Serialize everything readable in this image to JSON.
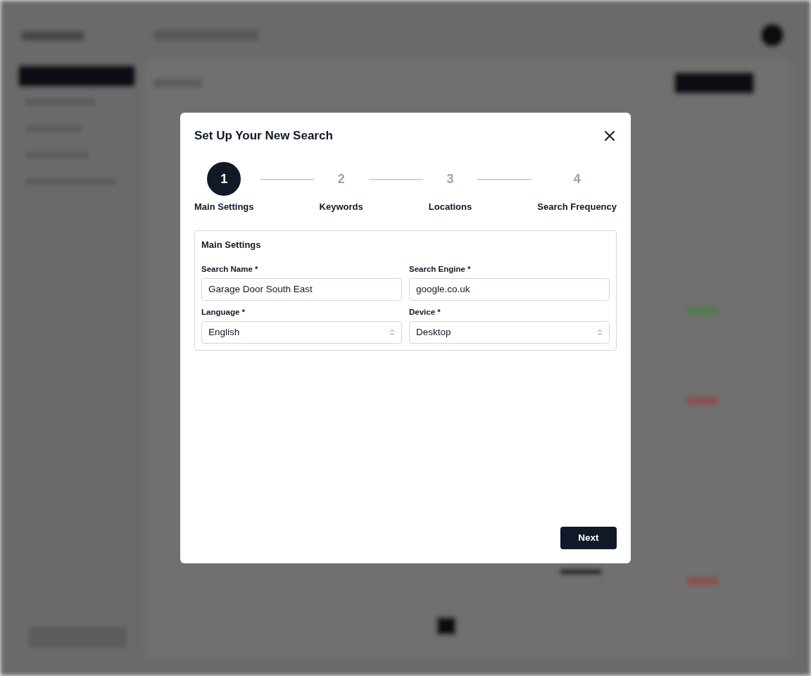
{
  "dialog": {
    "title": "Set Up Your New Search",
    "steps": [
      {
        "number": "1",
        "label": "Main Settings",
        "selected": true
      },
      {
        "number": "2",
        "label": "Keywords",
        "selected": false
      },
      {
        "number": "3",
        "label": "Locations",
        "selected": false
      },
      {
        "number": "4",
        "label": "Search Frequency",
        "selected": false
      }
    ],
    "section": {
      "title": "Main Settings",
      "fields": [
        {
          "kind": "text",
          "label": "Search Name *",
          "value": "Garage Door South East"
        },
        {
          "kind": "text",
          "label": "Search Engine *",
          "value": "google.co.uk"
        },
        {
          "kind": "select",
          "label": "Language *",
          "value": "English"
        },
        {
          "kind": "select",
          "label": "Device *",
          "value": "Desktop"
        }
      ]
    },
    "next_button": "Next"
  }
}
